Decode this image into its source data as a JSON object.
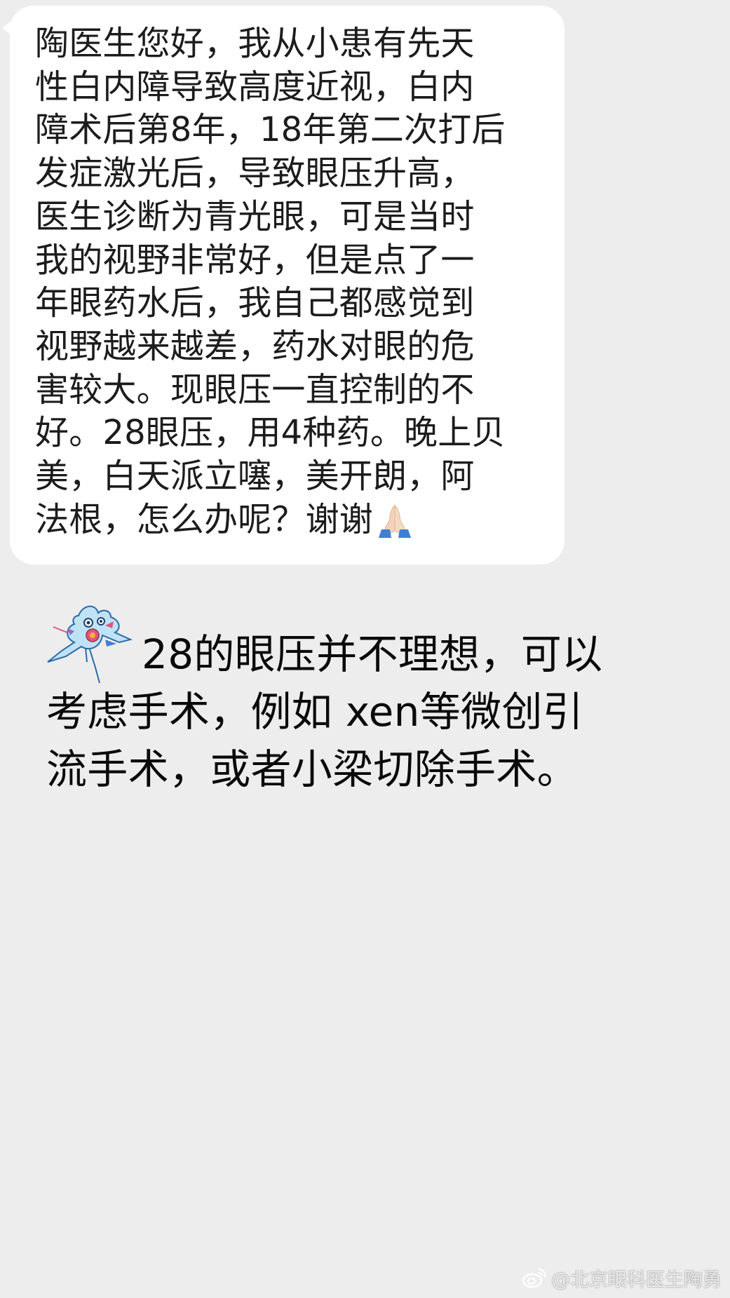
{
  "incoming_message": {
    "lines": [
      "陶医生您好，我从小患有先天",
      "性白内障导致高度近视，白内",
      "障术后第8年，18年第二次打后",
      "发症激光后，导致眼压升高，",
      "医生诊断为青光眼，可是当时",
      "我的视野非常好，但是点了一",
      "年眼药水后，我自己都感觉到",
      "视野越来越差，药水对眼的危",
      "害较大。现眼压一直控制的不",
      "好。28眼压，用4种药。晚上贝",
      "美，白天派立噻，美开朗，阿",
      "法根，怎么办呢？谢谢"
    ],
    "trailing_emoji": "pray-icon"
  },
  "reply": {
    "lines": [
      "28的眼压并不理想，可以",
      "考虑手术，例如 xen等微创引",
      "流手术，或者小梁切除手术。"
    ],
    "leading_emoji": "kite-icon"
  },
  "watermark": {
    "text": "@北京眼科医生陶勇",
    "icon": "weibo-icon"
  },
  "colors": {
    "background": "#ededed",
    "bubble": "#ffffff",
    "text": "#1c1c1c"
  }
}
